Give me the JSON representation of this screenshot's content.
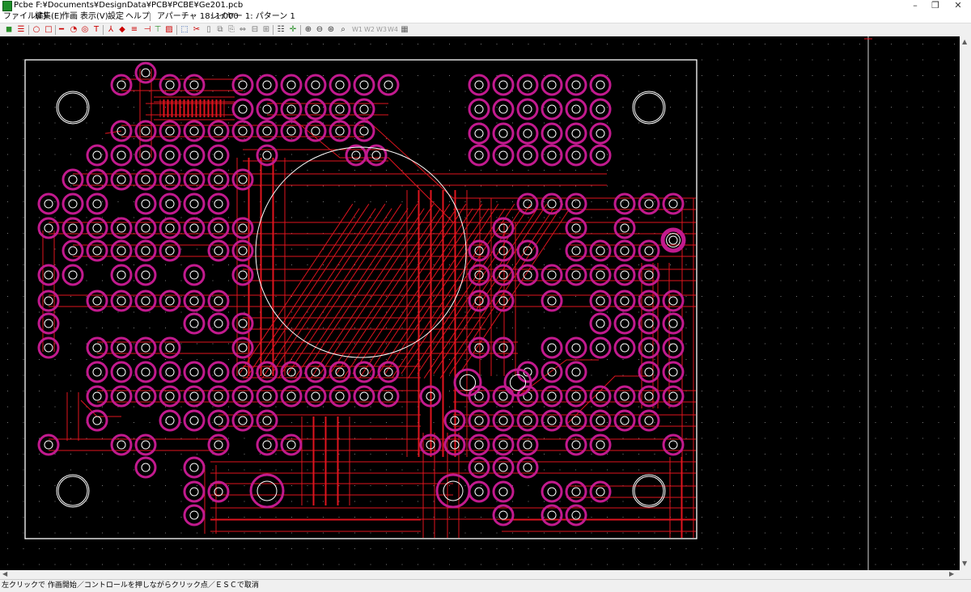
{
  "window": {
    "title": "Pcbe F:¥Documents¥DesignData¥PCB¥PCBE¥Ge201.pcb",
    "minimize_glyph": "–",
    "restore_glyph": "❐",
    "close_glyph": "✕"
  },
  "menu": {
    "items": [
      "ファイル(F)",
      "編集(E)",
      "作画",
      "表示(V)",
      "設定",
      "ヘルプ"
    ],
    "aperture": "アパーチャ 18: 1.000",
    "layer": "レイヤー 1: パターン 1"
  },
  "toolbar": {
    "w_buttons": [
      "W1",
      "W2",
      "W3",
      "W4"
    ]
  },
  "scrollbar": {
    "up": "▲",
    "down": "▼",
    "left": "◀",
    "right": "▶"
  },
  "status": {
    "text": "左クリックで 作画開始／コントロールを押しながらクリック点／ＥＳＣで取消"
  },
  "colors": {
    "background": "#000000",
    "track": "#e0141e",
    "pad_outer": "#c21a8e",
    "pad_inner": "#ffffff",
    "board_outline": "#ffffff"
  }
}
